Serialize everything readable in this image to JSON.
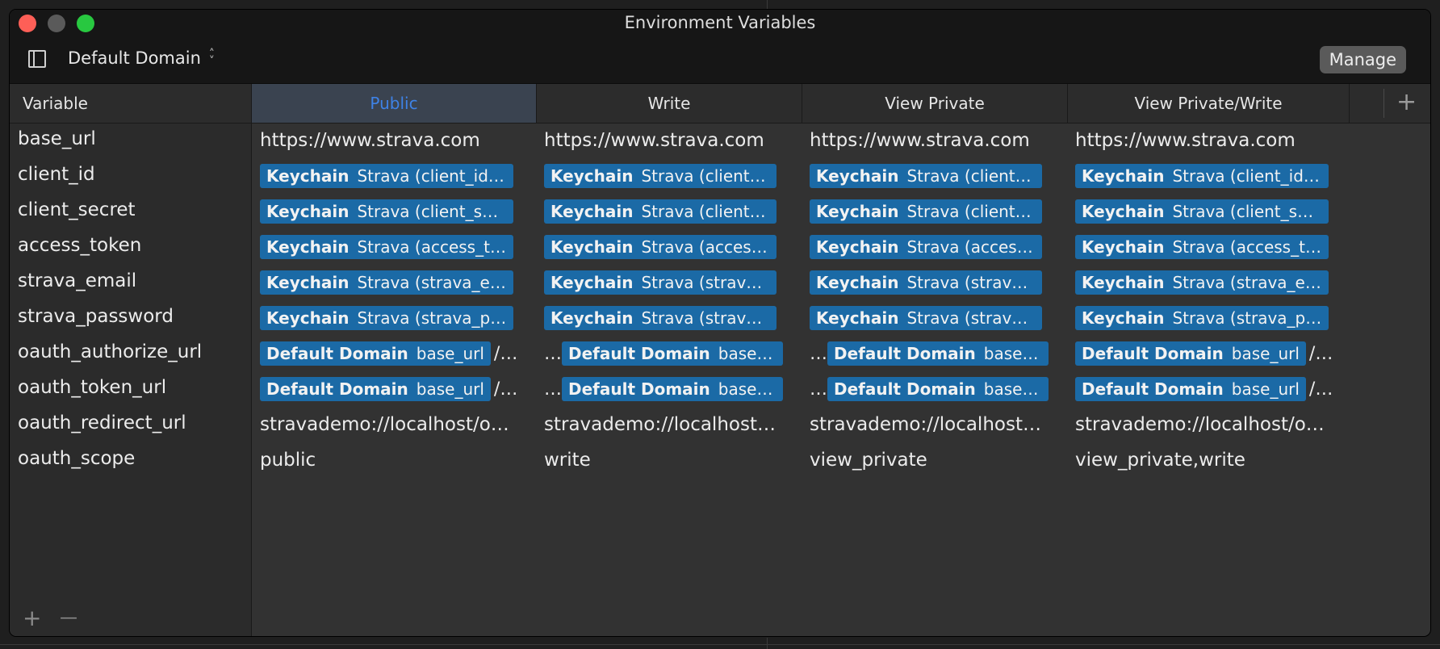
{
  "window": {
    "title": "Environment Variables",
    "domain_selector": "Default Domain",
    "manage_label": "Manage"
  },
  "columns": {
    "variable_header": "Variable",
    "environments": [
      "Public",
      "Write",
      "View Private",
      "View Private/Write"
    ],
    "active_index": 0,
    "add_label": "+"
  },
  "variables": [
    "base_url",
    "client_id",
    "client_secret",
    "access_token",
    "strava_email",
    "strava_password",
    "oauth_authorize_url",
    "oauth_token_url",
    "oauth_redirect_url",
    "oauth_scope"
  ],
  "values": {
    "public": {
      "base_url": "https://www.strava.com",
      "client_id": {
        "kind": "Keychain",
        "text": "Strava (client_id)…"
      },
      "client_secret": {
        "kind": "Keychain",
        "text": "Strava (client_se…"
      },
      "access_token": {
        "kind": "Keychain",
        "text": "Strava (access_t…"
      },
      "strava_email": {
        "kind": "Keychain",
        "text": "Strava (strava_e…"
      },
      "strava_password": {
        "kind": "Keychain",
        "text": "Strava (strava_pa…"
      },
      "oauth_authorize_url": {
        "kind": "Default Domain",
        "text": "base_url",
        "suffix": "/…"
      },
      "oauth_token_url": {
        "kind": "Default Domain",
        "text": "base_url",
        "suffix": "/…"
      },
      "oauth_redirect_url": "stravademo://localhost/o…",
      "oauth_scope": "public"
    },
    "write": {
      "base_url": "https://www.strava.com",
      "client_id": {
        "kind": "Keychain",
        "text": "Strava (client_i…"
      },
      "client_secret": {
        "kind": "Keychain",
        "text": "Strava (client_…"
      },
      "access_token": {
        "kind": "Keychain",
        "text": "Strava (access…"
      },
      "strava_email": {
        "kind": "Keychain",
        "text": "Strava (strava_…"
      },
      "strava_password": {
        "kind": "Keychain",
        "text": "Strava (strava_…"
      },
      "oauth_authorize_url": {
        "prefix": "…",
        "kind": "Default Domain",
        "text": "base_url"
      },
      "oauth_token_url": {
        "prefix": "…",
        "kind": "Default Domain",
        "text": "base_url"
      },
      "oauth_redirect_url": "stravademo://localhost…",
      "oauth_scope": "write"
    },
    "view_private": {
      "base_url": "https://www.strava.com",
      "client_id": {
        "kind": "Keychain",
        "text": "Strava (client_i…"
      },
      "client_secret": {
        "kind": "Keychain",
        "text": "Strava (client_…"
      },
      "access_token": {
        "kind": "Keychain",
        "text": "Strava (access…"
      },
      "strava_email": {
        "kind": "Keychain",
        "text": "Strava (strava_…"
      },
      "strava_password": {
        "kind": "Keychain",
        "text": "Strava (strava_…"
      },
      "oauth_authorize_url": {
        "prefix": "…",
        "kind": "Default Domain",
        "text": "base_url"
      },
      "oauth_token_url": {
        "prefix": "…",
        "kind": "Default Domain",
        "text": "base_url"
      },
      "oauth_redirect_url": "stravademo://localhost…",
      "oauth_scope": "view_private"
    },
    "view_private_write": {
      "base_url": "https://www.strava.com",
      "client_id": {
        "kind": "Keychain",
        "text": "Strava (client_id)…"
      },
      "client_secret": {
        "kind": "Keychain",
        "text": "Strava (client_se…"
      },
      "access_token": {
        "kind": "Keychain",
        "text": "Strava (access_t…"
      },
      "strava_email": {
        "kind": "Keychain",
        "text": "Strava (strava_e…"
      },
      "strava_password": {
        "kind": "Keychain",
        "text": "Strava (strava_p…"
      },
      "oauth_authorize_url": {
        "kind": "Default Domain",
        "text": "base_url",
        "suffix": "/…"
      },
      "oauth_token_url": {
        "kind": "Default Domain",
        "text": "base_url",
        "suffix": "/…"
      },
      "oauth_redirect_url": "stravademo://localhost/o…",
      "oauth_scope": "view_private,write"
    }
  },
  "footer": {
    "add_label": "+",
    "remove_label": "—"
  },
  "colors": {
    "token_bg": "#1b6aa6",
    "active_header_text": "#3e82e6",
    "close": "#fe5f57",
    "zoom": "#28c840"
  }
}
